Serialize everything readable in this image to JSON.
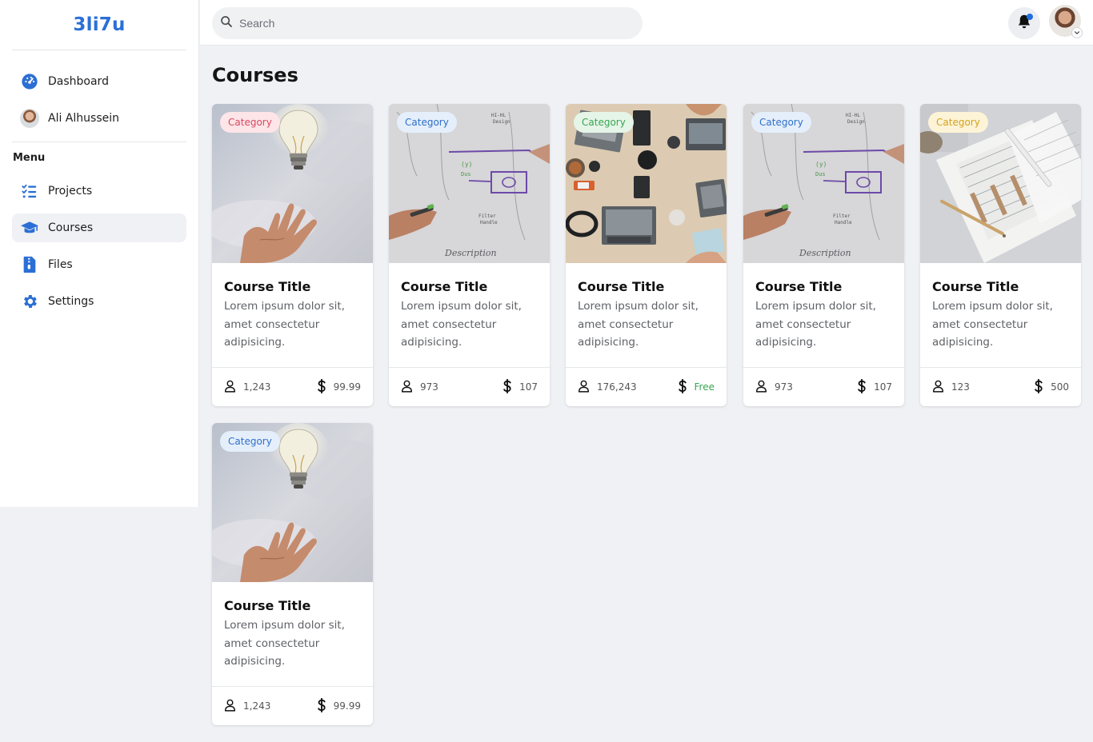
{
  "brand": "3li7u",
  "sidebar": {
    "items": [
      {
        "label": "Dashboard",
        "icon": "dashboard-icon"
      },
      {
        "label": "Ali Alhussein",
        "icon": "user-avatar"
      }
    ],
    "menu_heading": "Menu",
    "menu": [
      {
        "label": "Projects",
        "icon": "checklist-icon",
        "active": false
      },
      {
        "label": "Courses",
        "icon": "graduation-cap-icon",
        "active": true
      },
      {
        "label": "Files",
        "icon": "file-icon",
        "active": false
      },
      {
        "label": "Settings",
        "icon": "gear-icon",
        "active": false
      }
    ]
  },
  "search": {
    "placeholder": "Search"
  },
  "notifications": {
    "has_unread": true
  },
  "page": {
    "title": "Courses"
  },
  "colors": {
    "accent": "#2b6fd6",
    "badge_red": "#d9485f",
    "badge_blue": "#2f6fc9",
    "badge_green": "#3aa552",
    "badge_yellow": "#d4a11e",
    "free_green": "#3aa552"
  },
  "courses": [
    {
      "category": "Category",
      "badge": "red",
      "image": "lightbulb",
      "title": "Course Title",
      "description": "Lorem ipsum dolor sit, amet consectetur adipisicing.",
      "students": "1,243",
      "price": "99.99",
      "free": false
    },
    {
      "category": "Category",
      "badge": "blue",
      "image": "whiteboard",
      "title": "Course Title",
      "description": "Lorem ipsum dolor sit, amet consectetur adipisicing.",
      "students": "973",
      "price": "107",
      "free": false
    },
    {
      "category": "Category",
      "badge": "green",
      "image": "laptops",
      "title": "Course Title",
      "description": "Lorem ipsum dolor sit, amet consectetur adipisicing.",
      "students": "176,243",
      "price": "Free",
      "free": true
    },
    {
      "category": "Category",
      "badge": "blue",
      "image": "whiteboard",
      "title": "Course Title",
      "description": "Lorem ipsum dolor sit, amet consectetur adipisicing.",
      "students": "973",
      "price": "107",
      "free": false
    },
    {
      "category": "Category",
      "badge": "yellow",
      "image": "documents",
      "title": "Course Title",
      "description": "Lorem ipsum dolor sit, amet consectetur adipisicing.",
      "students": "123",
      "price": "500",
      "free": false
    },
    {
      "category": "Category",
      "badge": "blue",
      "image": "lightbulb",
      "title": "Course Title",
      "description": "Lorem ipsum dolor sit, amet consectetur adipisicing.",
      "students": "1,243",
      "price": "99.99",
      "free": false
    }
  ]
}
